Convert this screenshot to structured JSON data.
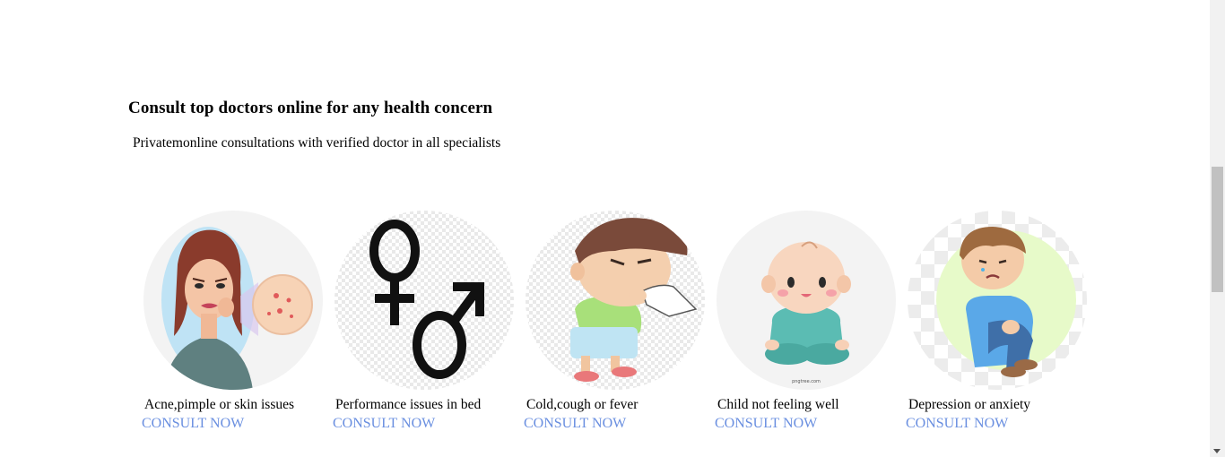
{
  "section": {
    "title": "Consult top doctors online for any health concern",
    "subtitle": "Privatemonline consultations with verified doctor in all specialists"
  },
  "cards": [
    {
      "title": "Acne,pimple or skin issues",
      "cta": "CONSULT NOW",
      "image_icon": "woman-acne-icon"
    },
    {
      "title": "Performance issues in bed",
      "cta": "CONSULT NOW",
      "image_icon": "gender-symbols-icon"
    },
    {
      "title": "Cold,cough or fever",
      "cta": "CONSULT NOW",
      "image_icon": "sneezing-boy-icon"
    },
    {
      "title": "Child not feeling well",
      "cta": "CONSULT NOW",
      "image_icon": "baby-icon"
    },
    {
      "title": "Depression or anxiety",
      "cta": "CONSULT NOW",
      "image_icon": "sad-boy-icon"
    }
  ],
  "colors": {
    "cta": "#6a8fe0",
    "text": "#000000",
    "circle_bg": "#f3f3f3"
  },
  "watermark": "pngtree.com"
}
